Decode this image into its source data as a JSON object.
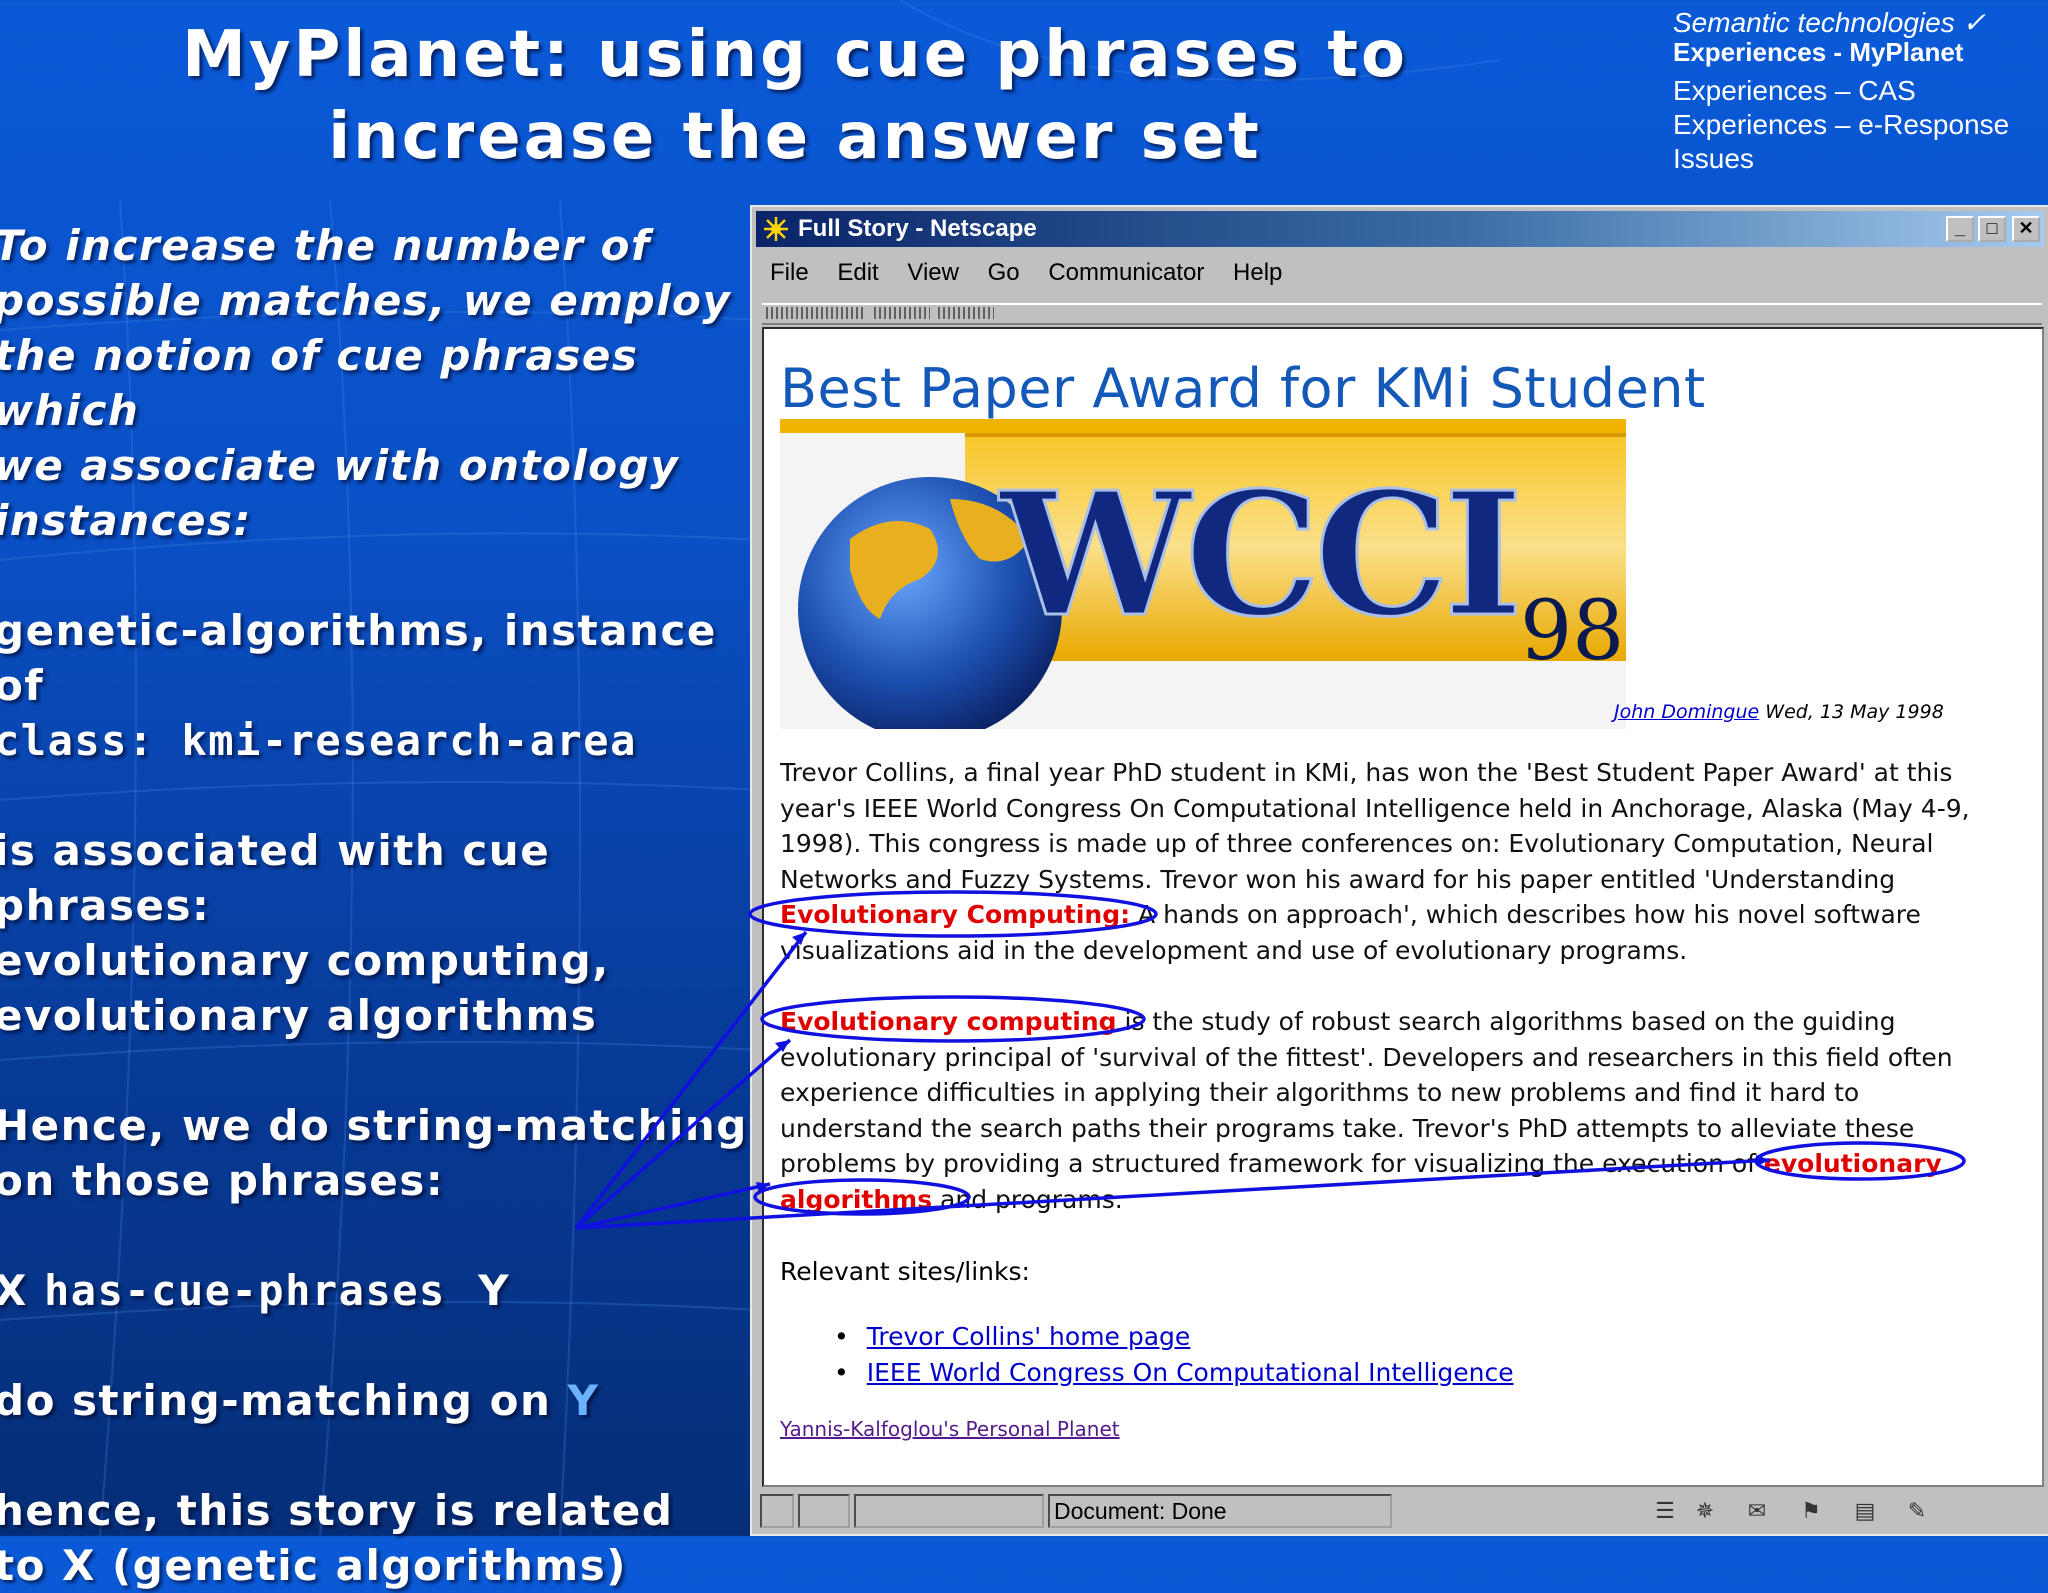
{
  "slide": {
    "title": "MyPlanet: using cue phrases to increase the answer set",
    "nav": [
      {
        "label": "Semantic technologies ✓",
        "state": "done"
      },
      {
        "label": "Experiences - MyPlanet",
        "state": "current"
      },
      {
        "label": "Experiences – CAS",
        "state": "pending"
      },
      {
        "label": "Experiences – e-Response",
        "state": "pending"
      },
      {
        "label": "Issues",
        "state": "pending"
      }
    ],
    "left": {
      "intro": [
        "To increase the number of",
        "possible matches, we employ",
        "the notion of cue phrases which",
        "we associate with ontology",
        "instances:"
      ],
      "instance_term": "genetic-algorithms",
      "instance_rest": ", instance of",
      "class_line": "class: kmi-research-area",
      "assoc": [
        "is associated with cue phrases:",
        "evolutionary computing,",
        "evolutionary algorithms"
      ],
      "hence": [
        "Hence, we do string-matching",
        "on those phrases:"
      ],
      "rule_x": "X",
      "rule_rel": "has-cue-phrases",
      "rule_y": "Y",
      "match_text": "do string-matching on",
      "match_y": "Y",
      "conclusion": [
        "hence, this story is related",
        "to X (genetic algorithms)"
      ]
    }
  },
  "browser": {
    "window_title": "Full Story - Netscape",
    "menu": [
      "File",
      "Edit",
      "View",
      "Go",
      "Communicator",
      "Help"
    ],
    "headline": "Best Paper Award for KMi Student",
    "banner_text": "WCCI",
    "banner_year": "98",
    "author": "John Domingue",
    "date": "Wed, 13 May 1998",
    "p1_lines": [
      "Trevor Collins, a final year PhD student in KMi, has won the 'Best Student Paper Award' at this",
      "year's IEEE World Congress On Computational Intelligence held in Anchorage, Alaska (May 4-9,",
      "1998). This congress is made up of three conferences on: Evolutionary Computation, Neural",
      "Networks and Fuzzy Systems. Trevor won his award for his paper entitled 'Understanding"
    ],
    "p1_hl": "Evolutionary Computing:",
    "p1_line5_rest": " A hands on approach', which describes how his novel software",
    "p1_line6": "visualizations aid in the development and use of evolutionary programs.",
    "p2_hl": "Evolutionary computing",
    "p2_line1_rest": " is the study of robust search algorithms based on the guiding",
    "p2_lines": [
      "evolutionary principal of 'survival of the fittest'. Developers and researchers in this field often",
      "experience difficulties in applying their algorithms to new problems and find it hard to",
      "understand the search paths their programs take. Trevor's PhD attempts to alleviate these"
    ],
    "p2_line5": "problems by providing a structured framework for visualizing the execution of ",
    "p2_hl2": "evolutionary",
    "p2_hl3": "algorithms",
    "p2_line6_rest": " and programs.",
    "relevant_label": "Relevant sites/links:",
    "links": [
      "Trevor Collins' home page",
      "IEEE World Congress On Computational Intelligence"
    ],
    "footer_link": "Yannis-Kalfoglou's Personal Planet",
    "status": "Document: Done"
  },
  "colors": {
    "highlight": "#e00000",
    "link": "#0000cc",
    "annotation": "#1010e0",
    "headline": "#1559b8",
    "y_highlight": "#6ab4ff"
  }
}
